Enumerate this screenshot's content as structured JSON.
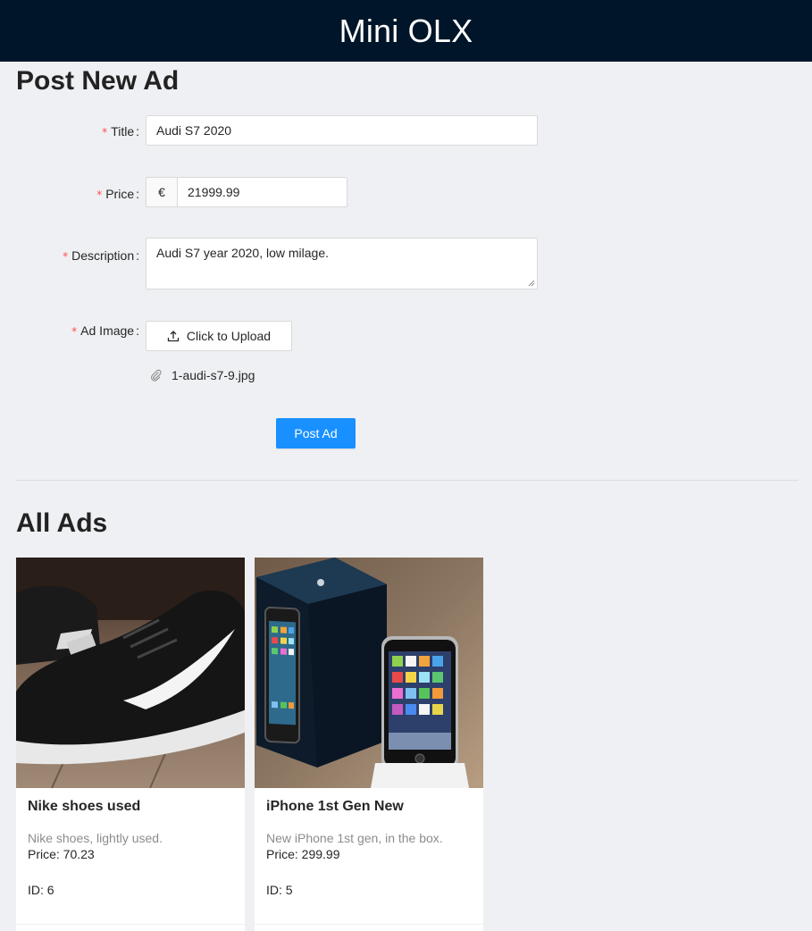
{
  "header": {
    "title": "Mini OLX"
  },
  "post_form": {
    "heading": "Post New Ad",
    "title_field": {
      "label": "Title",
      "value": "Audi S7 2020"
    },
    "price_field": {
      "label": "Price",
      "addon": "€",
      "value": "21999.99"
    },
    "description_field": {
      "label": "Description",
      "value": "Audi S7 year 2020, low milage."
    },
    "image_field": {
      "label": "Ad Image",
      "upload_label": "Click to Upload",
      "file_name": "1-audi-s7-9.jpg"
    },
    "required_mark": "*",
    "colon": ":",
    "submit_label": "Post Ad"
  },
  "ads_section": {
    "heading": "All Ads",
    "ads": [
      {
        "title": "Nike shoes used",
        "description": "Nike shoes, lightly used.",
        "price": "Price: 70.23",
        "id": "ID: 6",
        "image": "black-sneaker-photo"
      },
      {
        "title": "iPhone 1st Gen New",
        "description": "New iPhone 1st gen, in the box.",
        "price": "Price: 299.99",
        "id": "ID: 5",
        "image": "iphone-box-photo"
      }
    ]
  },
  "colors": {
    "header_bg": "#001529",
    "primary": "#1890ff",
    "page_bg": "#eff0f3",
    "required": "#ff4d4f"
  }
}
